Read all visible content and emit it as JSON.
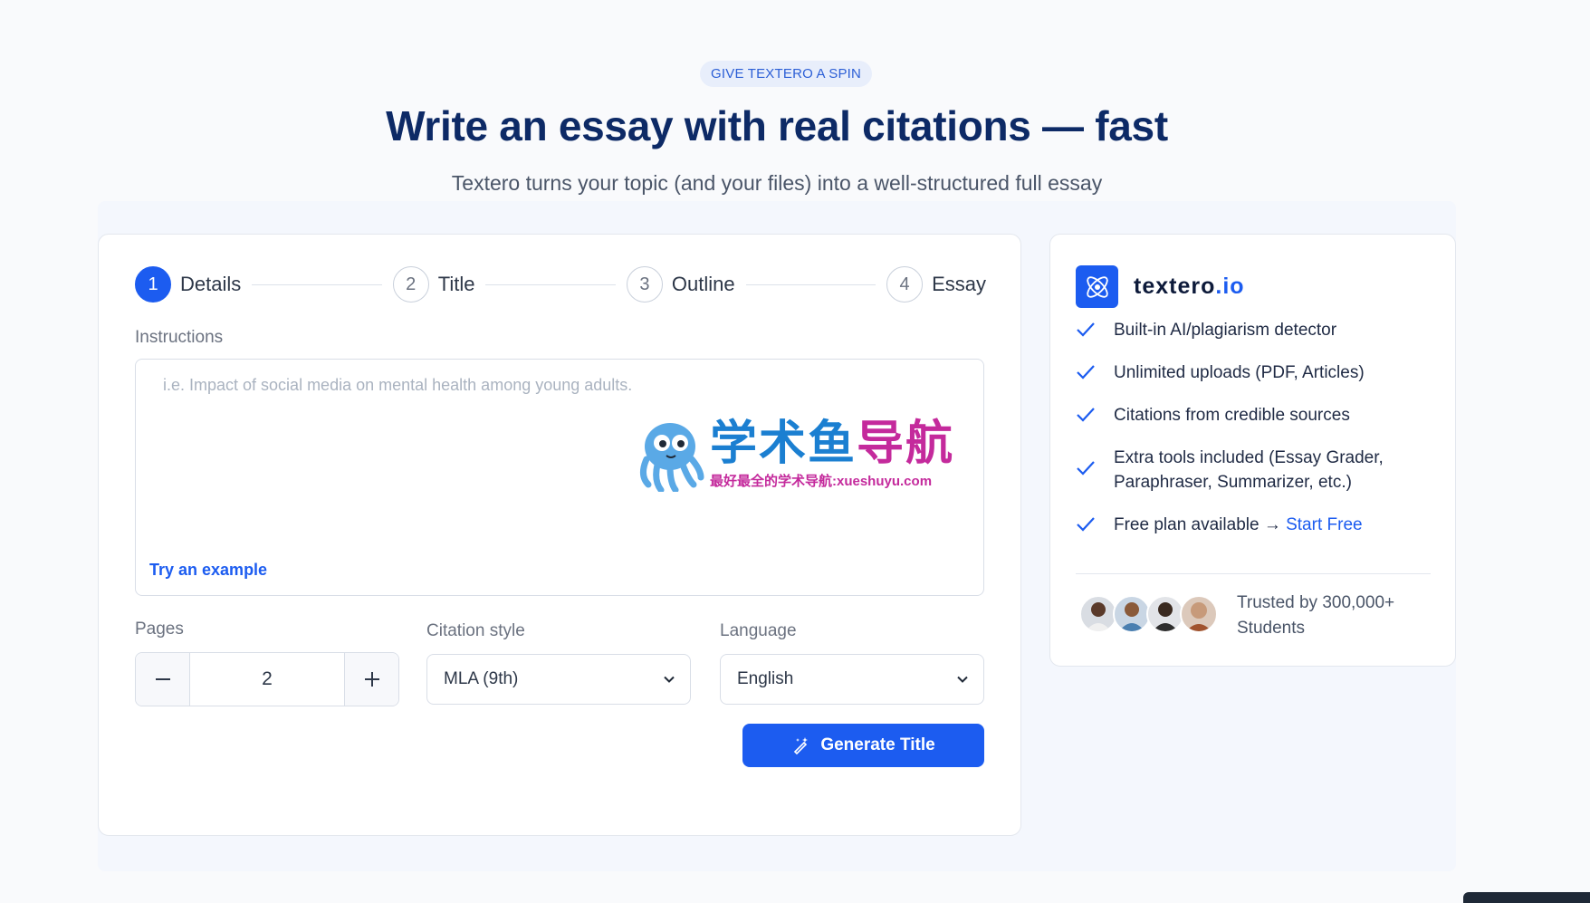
{
  "hero": {
    "badge": "GIVE TEXTERO A SPIN",
    "title": "Write an essay with real citations — fast",
    "subtitle": "Textero turns your topic (and your files) into a well-structured full essay"
  },
  "stepper": [
    {
      "num": "1",
      "label": "Details"
    },
    {
      "num": "2",
      "label": "Title"
    },
    {
      "num": "3",
      "label": "Outline"
    },
    {
      "num": "4",
      "label": "Essay"
    }
  ],
  "form": {
    "instructions_label": "Instructions",
    "instructions_placeholder": "i.e. Impact of social media on mental health among young adults.",
    "try_example": "Try an example",
    "pages_label": "Pages",
    "pages_value": "2",
    "citation_label": "Citation style",
    "citation_value": "MLA (9th)",
    "language_label": "Language",
    "language_value": "English",
    "generate_button": "Generate Title"
  },
  "watermark": {
    "title_a": "学术鱼",
    "title_b": "导航",
    "subtitle": "最好最全的学术导航:xueshuyu.com"
  },
  "side": {
    "brand_a": "textero",
    "brand_b": ".io",
    "features": [
      "Built-in AI/plagiarism detector",
      "Unlimited uploads (PDF, Articles)",
      "Citations from credible sources",
      "Extra tools included (Essay Grader, Paraphraser, Summarizer, etc.)",
      "Free plan available →"
    ],
    "start_free": "Start Free",
    "trusted": "Trusted by 300,000+ Students"
  },
  "colors": {
    "accent": "#1c5cf0",
    "heading": "#0d2a66"
  }
}
